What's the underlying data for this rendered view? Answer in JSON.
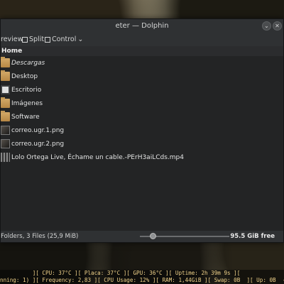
{
  "window": {
    "title": "eter — Dolphin",
    "buttons": [
      "minimize",
      "close"
    ]
  },
  "toolbar": {
    "preview_label": "review",
    "split_label": "Split",
    "control_label": "Control",
    "control_suffix": "⌄"
  },
  "breadcrumb": {
    "label": "Home"
  },
  "files": [
    {
      "name": "Descargas",
      "icon": "download-folder-icon",
      "type": "folder",
      "selected": true
    },
    {
      "name": "Desktop",
      "icon": "folder-icon",
      "type": "folder",
      "selected": false
    },
    {
      "name": "Escritorio",
      "icon": "desktop-icon",
      "type": "folder",
      "selected": false
    },
    {
      "name": "Imágenes",
      "icon": "pictures-folder-icon",
      "type": "folder",
      "selected": false
    },
    {
      "name": "Software",
      "icon": "folder-icon",
      "type": "folder",
      "selected": false
    },
    {
      "name": "correo.ugr.1.png",
      "icon": "image-icon",
      "type": "file",
      "selected": false
    },
    {
      "name": "correo.ugr.2.png",
      "icon": "image-icon",
      "type": "file",
      "selected": false
    },
    {
      "name": "Lolo Ortega Live, Échame un cable.-PErH3aiLCds.mp4",
      "icon": "video-icon",
      "type": "file",
      "selected": false
    }
  ],
  "statusbar": {
    "summary": "Folders, 3 Files (25,9 MiB)",
    "free_space": "95.5 GiB free"
  },
  "conky": {
    "line1": "          ][ CPU: 37°C ][ Placa: 37°C ][ GPU: 36°C ][ Uptime: 2h 39m 9s ][",
    "line2": "nning: 1) ][ Frequency: 2,83 ][ CPU Usage: 12% ][ RAM: 1,44GiB ][ Swap: 0B  ][ Up: 0B  - D"
  }
}
